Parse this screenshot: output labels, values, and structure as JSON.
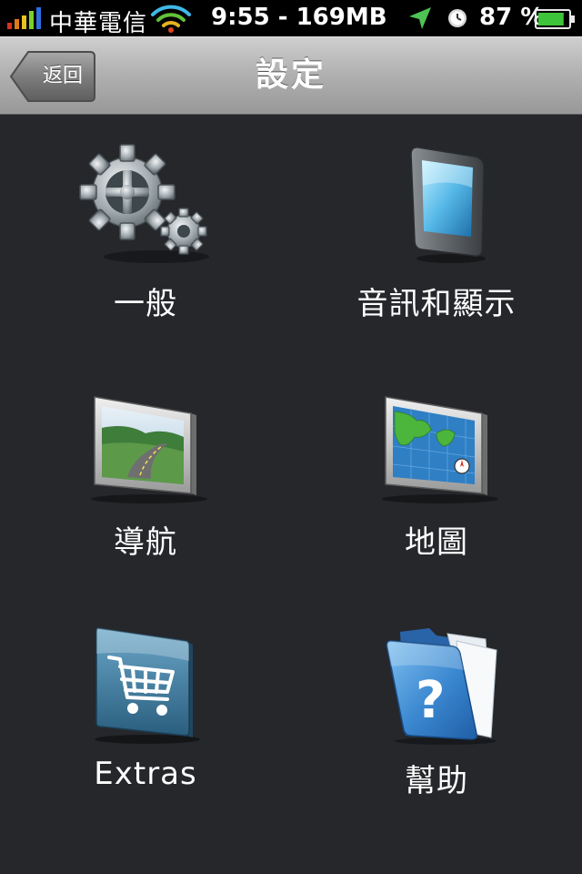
{
  "status_bar": {
    "carrier": "中華電信",
    "clock": "9:55 - 169MB",
    "battery_percent": "87 %",
    "battery_level": 0.87,
    "icons": [
      "signal-icon",
      "wifi-icon",
      "location-arrow-icon",
      "alarm-clock-icon",
      "battery-icon"
    ]
  },
  "nav": {
    "title": "設定",
    "back_label": "返回"
  },
  "menu": {
    "items": [
      {
        "label": "一般",
        "icon": "gears-icon"
      },
      {
        "label": "音訊和顯示",
        "icon": "device-icon"
      },
      {
        "label": "導航",
        "icon": "road-screen-icon"
      },
      {
        "label": "地圖",
        "icon": "map-screen-icon"
      },
      {
        "label": "Extras",
        "icon": "shopping-cart-icon"
      },
      {
        "label": "幫助",
        "icon": "help-folder-icon"
      }
    ]
  },
  "colors": {
    "background": "#25272b",
    "status_bar": "#000000",
    "nav_bar_top": "#cfcfcf",
    "nav_bar_bottom": "#989898",
    "battery_green": "#3ec43a",
    "accent_blue": "#4a8fd6"
  }
}
